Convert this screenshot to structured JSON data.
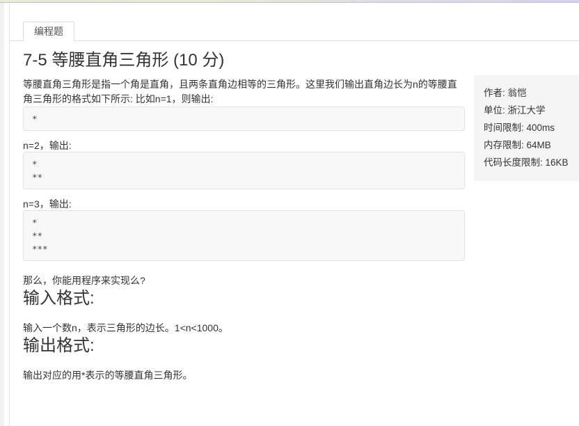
{
  "tabs": {
    "programming": "编程题"
  },
  "problem": {
    "title": "7-5 等腰直角三角形 (10 分)",
    "description": "等腰直角三角形是指一个角是直角，且两条直角边相等的三角形。这里我们输出直角边长为n的等腰直角三角形的格式如下所示: 比如n=1，则输出:",
    "example1_output": "*",
    "example2_label": "n=2，输出:",
    "example2_output": "*\n**",
    "example3_label": "n=3，输出:",
    "example3_output": "*\n**\n***",
    "question": "那么，你能用程序来实现么?",
    "input_format_heading": "输入格式:",
    "input_format_text": "输入一个数n，表示三角形的边长。1<n<1000。",
    "output_format_heading": "输出格式:",
    "output_format_text": "输出对应的用*表示的等腰直角三角形。"
  },
  "meta_panel": {
    "author": "作者: 翁恺",
    "organization": "单位: 浙江大学",
    "time_limit": "时间限制: 400ms",
    "memory_limit": "内存限制: 64MB",
    "code_length_limit": "代码长度限制: 16KB"
  },
  "colors": {
    "panel_bg": "#f5f5f5",
    "code_bg": "#f8f8f8",
    "border": "#dddddd",
    "topbar_left": "#eceadb",
    "topbar_right": "#d6d0e9",
    "text": "#333333"
  }
}
